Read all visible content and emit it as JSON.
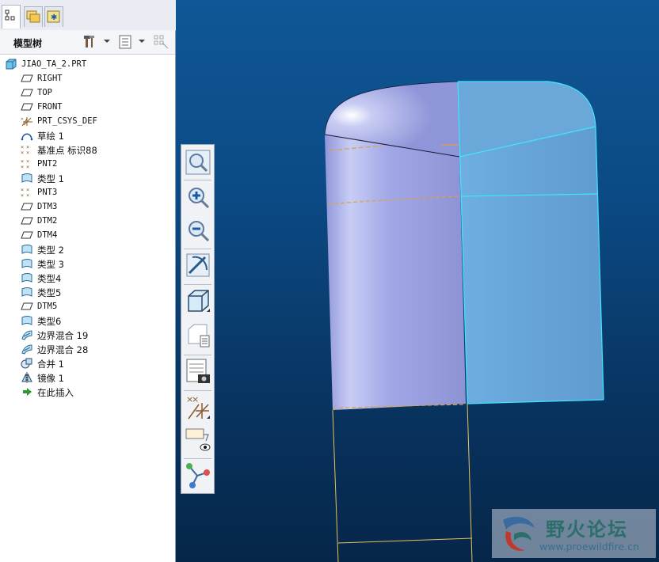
{
  "navigator": {
    "tabs": [
      {
        "name": "model-tree-tab",
        "icon": "model-tree-icon",
        "active": true
      },
      {
        "name": "folder-browser-tab",
        "icon": "folder-icon",
        "active": false
      },
      {
        "name": "favorites-tab",
        "icon": "favorites-icon",
        "active": false
      }
    ]
  },
  "tree_header": {
    "title": "模型树"
  },
  "tree": {
    "items": [
      {
        "label": "JIAO_TA_2.PRT",
        "icon": "part-icon"
      },
      {
        "label": "RIGHT",
        "icon": "datum-plane-icon"
      },
      {
        "label": "TOP",
        "icon": "datum-plane-icon"
      },
      {
        "label": "FRONT",
        "icon": "datum-plane-icon"
      },
      {
        "label": "PRT_CSYS_DEF",
        "icon": "coordinate-system-icon"
      },
      {
        "label": "草绘 1",
        "icon": "sketch-icon"
      },
      {
        "label": "基准点 标识88",
        "icon": "datum-point-icon"
      },
      {
        "label": "PNT2",
        "icon": "datum-point-icon"
      },
      {
        "label": "类型 1",
        "icon": "surface-feature-icon"
      },
      {
        "label": "PNT3",
        "icon": "datum-point-icon"
      },
      {
        "label": "DTM3",
        "icon": "datum-plane-icon"
      },
      {
        "label": "DTM2",
        "icon": "datum-plane-icon"
      },
      {
        "label": "DTM4",
        "icon": "datum-plane-icon"
      },
      {
        "label": "类型 2",
        "icon": "surface-feature-icon"
      },
      {
        "label": "类型 3",
        "icon": "surface-feature-icon"
      },
      {
        "label": "类型4",
        "icon": "surface-feature-icon"
      },
      {
        "label": "类型5",
        "icon": "surface-feature-icon"
      },
      {
        "label": "DTM5",
        "icon": "datum-plane-icon"
      },
      {
        "label": "类型6",
        "icon": "surface-feature-icon"
      },
      {
        "label": "边界混合 19",
        "icon": "boundary-blend-icon"
      },
      {
        "label": "边界混合 28",
        "icon": "boundary-blend-icon"
      },
      {
        "label": "合并 1",
        "icon": "merge-icon"
      },
      {
        "label": "镜像 1",
        "icon": "mirror-icon"
      },
      {
        "label": "在此插入",
        "icon": "insert-here-arrow-icon"
      }
    ]
  },
  "view_toolbar": {
    "buttons": [
      {
        "name": "refit-button",
        "icon": "zoom-fit-icon"
      },
      {
        "name": "zoom-in-button",
        "icon": "zoom-in-icon"
      },
      {
        "name": "zoom-out-button",
        "icon": "zoom-out-icon"
      },
      {
        "name": "repaint-button",
        "icon": "repaint-icon"
      },
      {
        "name": "display-style-button",
        "icon": "display-style-cube-icon"
      },
      {
        "name": "saved-views-button",
        "icon": "saved-views-icon"
      },
      {
        "name": "view-manager-button",
        "icon": "view-manager-camera-icon"
      },
      {
        "name": "datum-display-button",
        "icon": "datum-display-icon"
      },
      {
        "name": "annotation-display-button",
        "icon": "annotation-display-icon"
      },
      {
        "name": "spin-center-button",
        "icon": "spin-center-icon"
      }
    ]
  },
  "watermark": {
    "title": "野火论坛",
    "url": "www.proewildfire.cn"
  },
  "colors": {
    "surface_left": "#9aa3e0",
    "surface_right": "#6aa6d6",
    "edge_highlight": "#3fe6ff",
    "wire_yellow": "#e8c25a",
    "background_top": "#0f5796",
    "background_bottom": "#062649"
  }
}
